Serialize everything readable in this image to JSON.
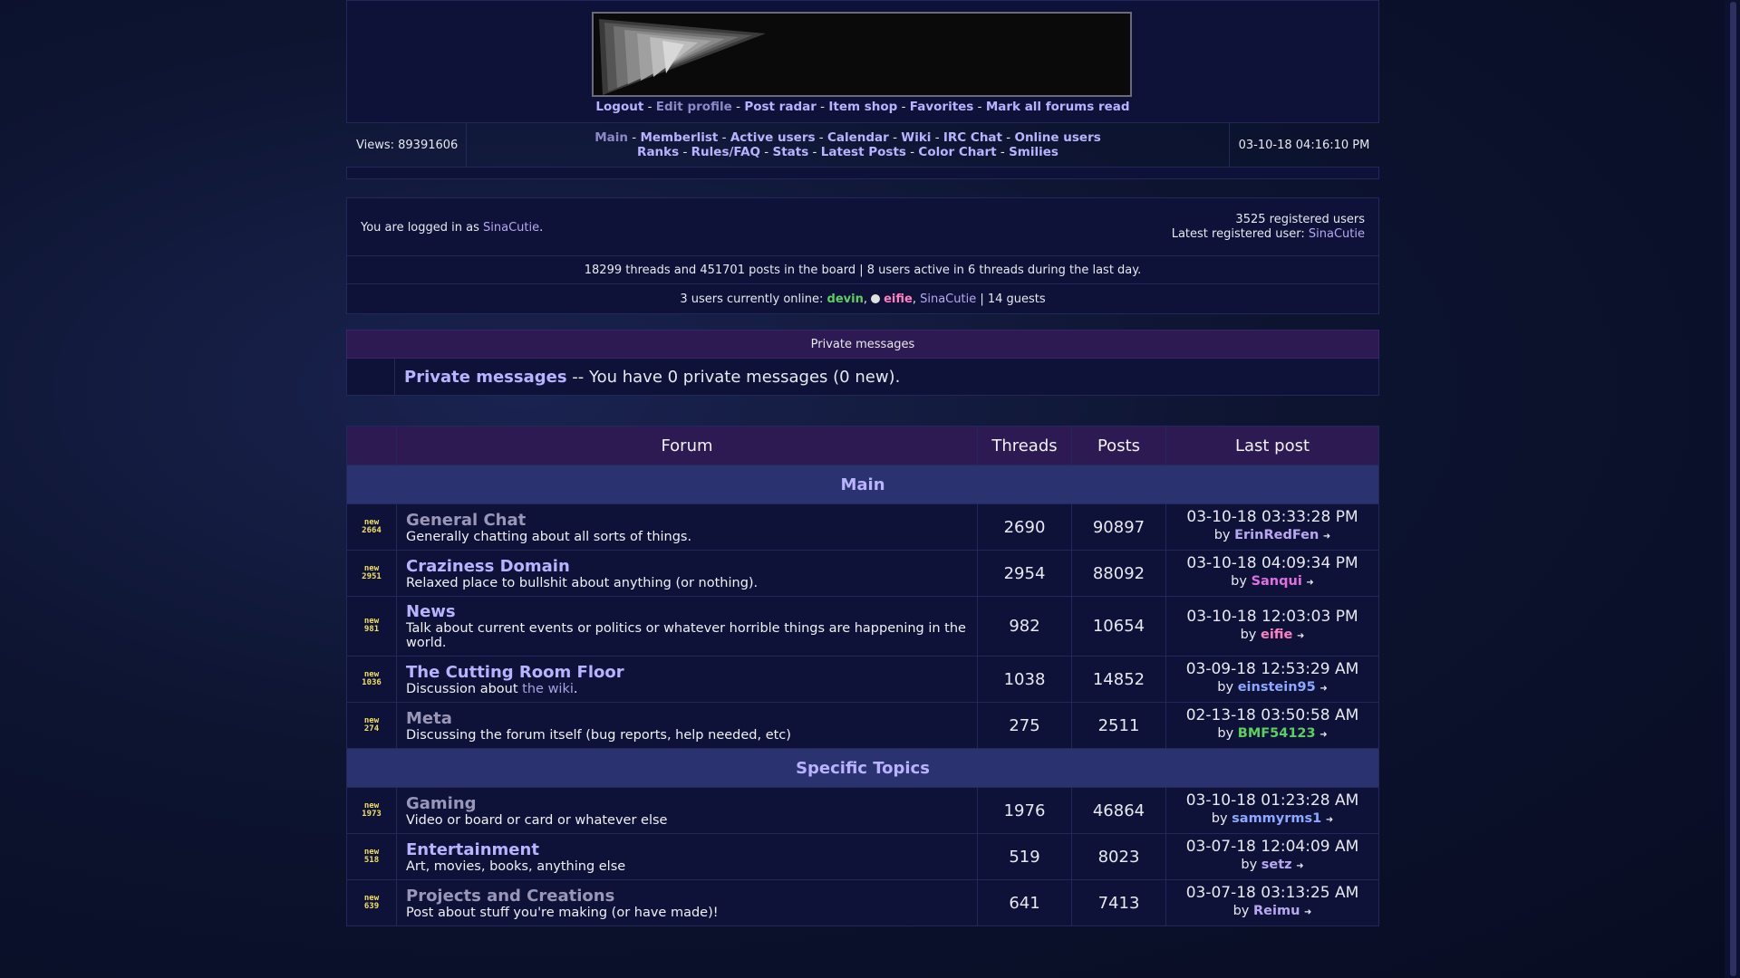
{
  "nav": {
    "top": [
      {
        "label": "Logout",
        "dim": false
      },
      {
        "label": "Edit profile",
        "dim": true
      },
      {
        "label": "Post radar",
        "dim": false
      },
      {
        "label": "Item shop",
        "dim": false
      },
      {
        "label": "Favorites",
        "dim": false
      },
      {
        "label": "Mark all forums read",
        "dim": false
      }
    ],
    "row1": [
      {
        "label": "Main",
        "dim": true
      },
      {
        "label": "Memberlist",
        "dim": false
      },
      {
        "label": "Active users",
        "dim": false
      },
      {
        "label": "Calendar",
        "dim": false
      },
      {
        "label": "Wiki",
        "dim": false
      },
      {
        "label": "IRC Chat",
        "dim": false
      },
      {
        "label": "Online users",
        "dim": false
      }
    ],
    "row2": [
      {
        "label": "Ranks",
        "dim": false
      },
      {
        "label": "Rules/FAQ",
        "dim": false
      },
      {
        "label": "Stats",
        "dim": false
      },
      {
        "label": "Latest Posts",
        "dim": false
      },
      {
        "label": "Color Chart",
        "dim": false
      },
      {
        "label": "Smilies",
        "dim": false
      }
    ]
  },
  "views": "Views: 89391606",
  "datetime": "03-10-18 04:16:10 PM",
  "login": {
    "prefix": "You are logged in as",
    "user": "SinaCutie",
    "registered": "3525 registered users",
    "latest_prefix": "Latest registered user:",
    "latest_user": "SinaCutie"
  },
  "board_stats": "18299 threads and 451701 posts in the board | 8 users active in 6 threads during the last day.",
  "online": {
    "prefix": "3 users currently online:",
    "users": [
      "devin",
      "eifie",
      "SinaCutie"
    ],
    "guests": "| 14 guests"
  },
  "pm": {
    "header": "Private messages",
    "link": "Private messages",
    "text": "-- You have 0 private messages (0 new)."
  },
  "table": {
    "headers": [
      "Forum",
      "Threads",
      "Posts",
      "Last post"
    ],
    "categories": [
      {
        "name": "Main",
        "forums": [
          {
            "badge": "new 2664",
            "name": "General Chat",
            "dim": true,
            "desc": "Generally chatting about all sorts of things.",
            "threads": "2690",
            "posts": "90897",
            "last": "03-10-18 03:33:28 PM",
            "by": "ErinRedFen",
            "by_color": "#b9a8f0"
          },
          {
            "badge": "new 2951",
            "name": "Craziness Domain",
            "dim": false,
            "desc": "Relaxed place to bullshit about anything (or nothing).",
            "threads": "2954",
            "posts": "88092",
            "last": "03-10-18 04:09:34 PM",
            "by": "Sanqui",
            "by_color": "#e070e0"
          },
          {
            "badge": "new 981",
            "name": "News",
            "dim": false,
            "desc": "Talk about current events or politics or whatever horrible things are happening in the world.",
            "threads": "982",
            "posts": "10654",
            "last": "03-10-18 12:03:03 PM",
            "by": "eifie",
            "by_color": "#ff7fc0"
          },
          {
            "badge": "new 1036",
            "name": "The Cutting Room Floor",
            "dim": false,
            "desc": "Discussion about",
            "desc_link": "the wiki",
            "desc_end": ".",
            "threads": "1038",
            "posts": "14852",
            "last": "03-09-18 12:53:29 AM",
            "by": "einstein95",
            "by_color": "#8fa8ff"
          },
          {
            "badge": "new 274",
            "name": "Meta",
            "dim": true,
            "desc": "Discussing the forum itself (bug reports, help needed, etc)",
            "threads": "275",
            "posts": "2511",
            "last": "02-13-18 03:50:58 AM",
            "by": "BMF54123",
            "by_color": "#5ad060"
          }
        ]
      },
      {
        "name": "Specific Topics",
        "forums": [
          {
            "badge": "new 1973",
            "name": "Gaming",
            "dim": true,
            "desc": "Video or board or card or whatever else",
            "threads": "1976",
            "posts": "46864",
            "last": "03-10-18 01:23:28 AM",
            "by": "sammyrms1",
            "by_color": "#8fa8ff"
          },
          {
            "badge": "new 518",
            "name": "Entertainment",
            "dim": false,
            "desc": "Art, movies, books, anything else",
            "threads": "519",
            "posts": "8023",
            "last": "03-07-18 12:04:09 AM",
            "by": "setz",
            "by_color": "#b9a8f0"
          },
          {
            "badge": "new 639",
            "name": "Projects and Creations",
            "dim": true,
            "desc": "Post about stuff you're making (or have made)!",
            "threads": "641",
            "posts": "7413",
            "last": "03-07-18 03:13:25 AM",
            "by": "Reimu",
            "by_color": "#b9a8f0"
          }
        ]
      }
    ]
  },
  "colors": {
    "accent": "#b9b3ff",
    "category_bg": "#2a3270",
    "header_bg": "#2e1a52",
    "panel_bg": "#0e1238"
  }
}
